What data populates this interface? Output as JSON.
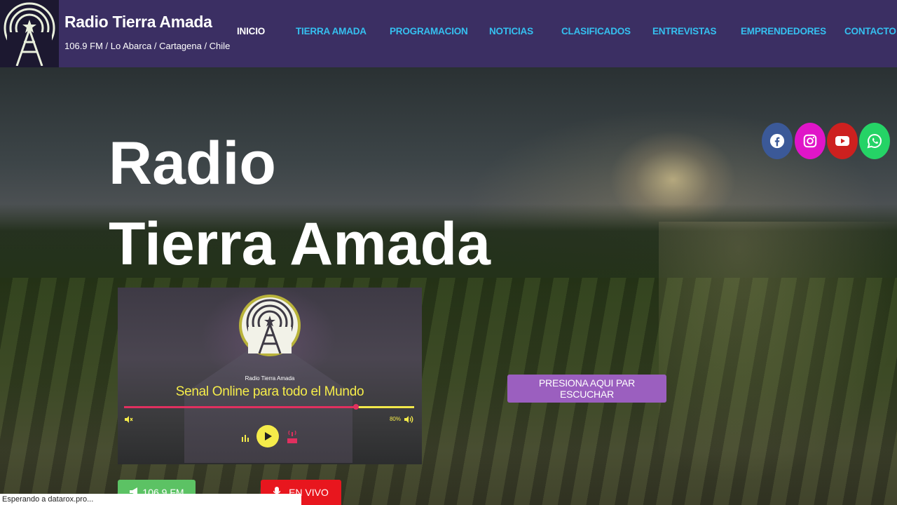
{
  "header": {
    "logo_icon": "radio-tower-icon",
    "title": "Radio Tierra Amada",
    "subtitle": "106.9 FM / Lo Abarca / Cartagena / Chile"
  },
  "nav": {
    "items": [
      {
        "label": "INICIO",
        "active": true
      },
      {
        "label": "TIERRA AMADA",
        "active": false
      },
      {
        "label": "PROGRAMACION",
        "active": false
      },
      {
        "label": "NOTICIAS",
        "active": false
      },
      {
        "label": "CLASIFICADOS",
        "active": false
      },
      {
        "label": "ENTREVISTAS",
        "active": false
      },
      {
        "label": "EMPRENDEDORES",
        "active": false
      },
      {
        "label": "CONTACTO",
        "active": false
      }
    ],
    "active_color": "#ffffff",
    "link_color": "#35c0f0"
  },
  "hero": {
    "title_line1": "Radio",
    "title_line2": "Tierra Amada"
  },
  "social": [
    {
      "name": "facebook-icon",
      "color": "#3b5998"
    },
    {
      "name": "instagram-icon",
      "color": "#e015c8"
    },
    {
      "name": "youtube-icon",
      "color": "#cd201f"
    },
    {
      "name": "whatsapp-icon",
      "color": "#25d366"
    }
  ],
  "player": {
    "station_label": "Radio Tierra Amada",
    "tagline": "Senal Online para todo el Mundo",
    "progress": 0.8,
    "volume_label": "80%",
    "live_tag": "LIVE",
    "icons": [
      "mute-icon",
      "volume-icon",
      "equalizer-icon",
      "play-icon",
      "live-icon"
    ]
  },
  "buttons": {
    "listen": "PRESIONA AQUI PAR ESCUCHAR",
    "fm": "106.9 FM",
    "live": "EN VIVO"
  },
  "status_bar": {
    "text": "Esperando a datarox.pro..."
  },
  "colors": {
    "header_bg": "#3b2f63",
    "listen_button": "#9b5fbf",
    "fm_button": "#5cc264",
    "live_button": "#e8161e",
    "player_accent": "#f5ec4a",
    "player_progress": "#e0305f"
  }
}
